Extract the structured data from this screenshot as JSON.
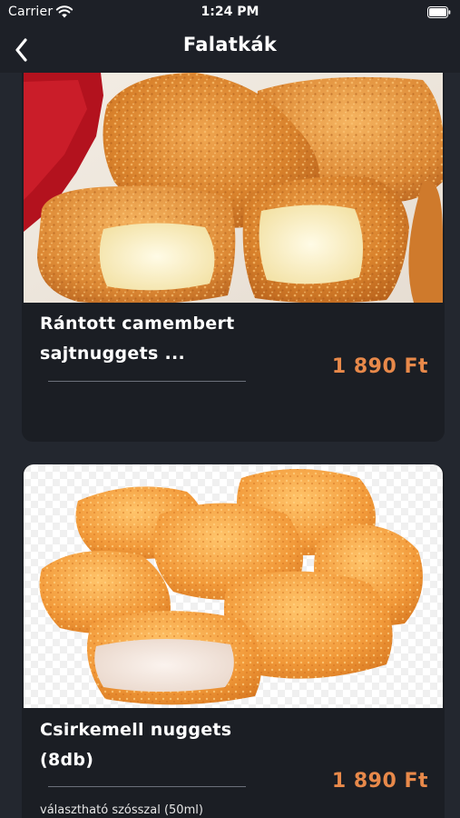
{
  "status_bar": {
    "carrier": "Carrier",
    "time": "1:24 PM"
  },
  "nav": {
    "title": "Falatkák",
    "back_icon": "chevron-left-icon"
  },
  "items": [
    {
      "title": "Rántott camembert sajtnuggets ...",
      "price": "1 890 Ft",
      "image": "fried-camembert-nuggets-photo"
    },
    {
      "title": "Csirkemell nuggets (8db)",
      "price": "1 890 Ft",
      "description": "választható szósszal (50ml)",
      "image": "chicken-nuggets-photo"
    }
  ],
  "colors": {
    "background": "#23272f",
    "bar": "#1d2027",
    "card": "#1b1e24",
    "price": "#e8894a"
  }
}
